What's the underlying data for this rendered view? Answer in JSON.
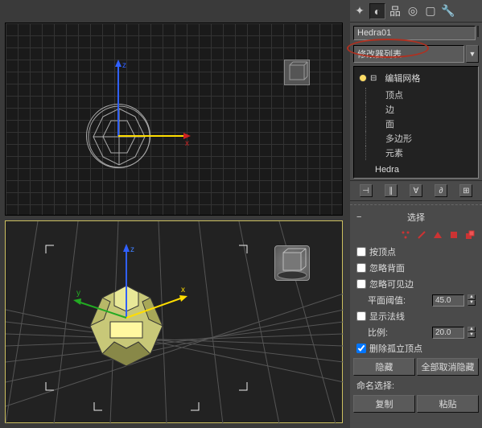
{
  "toolbar": {
    "icons": [
      "wrench-icon",
      "globe-icon",
      "hierarchy-icon",
      "motion-icon",
      "display-icon",
      "util-icon"
    ]
  },
  "object": {
    "name": "Hedra01"
  },
  "modifier": {
    "list_label": "修改器列表"
  },
  "stack": {
    "main": "编辑网格",
    "subs": [
      "顶点",
      "边",
      "面",
      "多边形",
      "元素"
    ],
    "base": "Hedra"
  },
  "rollout_selection": {
    "title": "选择"
  },
  "checks": {
    "by_vertex": "按顶点",
    "ignore_backface": "忽略背面",
    "ignore_vis_edges": "忽略可见边",
    "show_normals": "显示法线",
    "delete_isolated": "删除孤立顶点"
  },
  "spinners": {
    "planar_thresh_label": "平面阈值:",
    "planar_thresh_value": "45.0",
    "scale_label": "比例:",
    "scale_value": "20.0"
  },
  "buttons": {
    "hide": "隐藏",
    "unhide_all": "全部取消隐藏",
    "copy": "复制",
    "paste": "粘贴"
  },
  "labels": {
    "named_sel": "命名选择:"
  }
}
